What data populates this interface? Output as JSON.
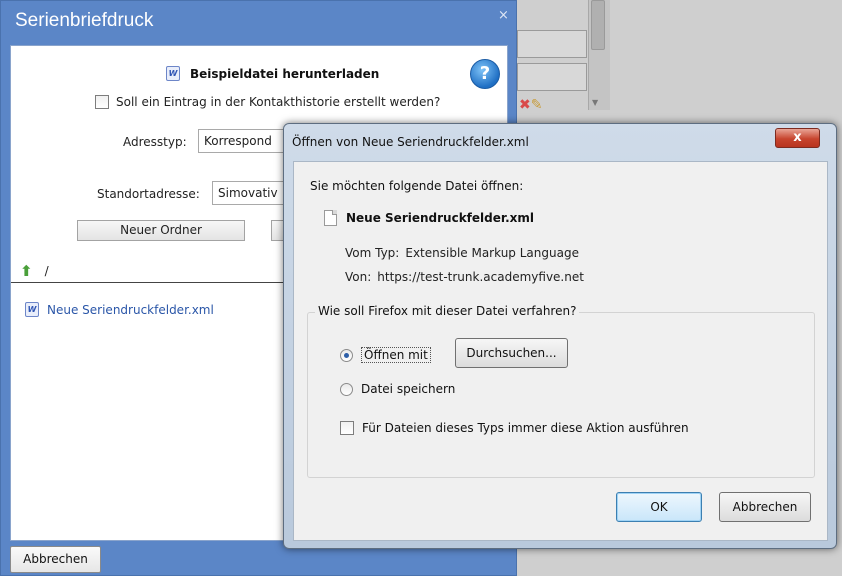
{
  "background": {
    "action_icons": [
      "close-icon",
      "pencil-icon"
    ]
  },
  "serien_dialog": {
    "title": "Serienbriefdruck",
    "close_glyph": "×",
    "download_label": "Beispieldatei herunterladen",
    "history_checkbox_label": "Soll ein Eintrag in der Kontakthistorie erstellt werden?",
    "adresstyp_label": "Adresstyp:",
    "adresstyp_value": "Korrespond",
    "standort_label": "Standortadresse:",
    "standort_value": "Simovativ",
    "new_folder_button": "Neuer Ordner",
    "path": "/",
    "file_name": "Neue Seriendruckfelder.xml",
    "cancel_button": "Abbrechen",
    "help_glyph": "?",
    "doc_glyph": "W"
  },
  "firefox_dialog": {
    "title": "Öffnen von Neue Seriendruckfelder.xml",
    "close_glyph": "x",
    "question": "Sie möchten folgende Datei öffnen:",
    "file_name": "Neue Seriendruckfelder.xml",
    "type_label": "Vom Typ:",
    "type_value": "Extensible Markup Language",
    "from_label": "Von:",
    "from_value": "https://test-trunk.academyfive.net",
    "group_label": "Wie soll Firefox mit dieser Datei verfahren?",
    "open_with_label": "Öffnen mit",
    "browse_button": "Durchsuchen...",
    "save_file_label": "Datei speichern",
    "always_label": "Für Dateien dieses Typs immer diese Aktion ausführen",
    "ok_button": "OK",
    "cancel_button": "Abbrechen",
    "selected_option": "open_with"
  }
}
